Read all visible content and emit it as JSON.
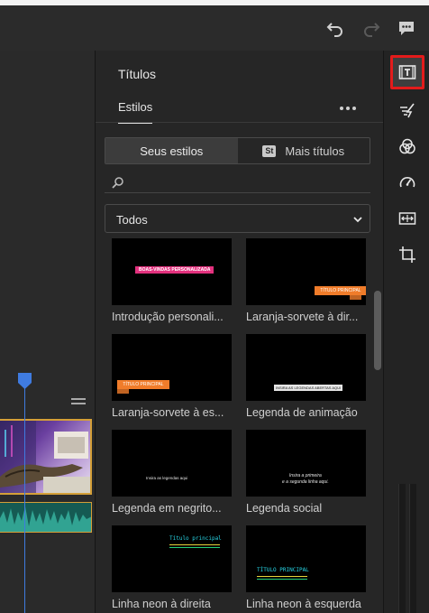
{
  "toolbar": {
    "undo_icon": "undo-icon",
    "redo_icon": "redo-icon",
    "comment_icon": "comment-icon"
  },
  "panel": {
    "title": "Títulos",
    "tab_label": "Estilos",
    "more_icon": "more-icon",
    "segment": {
      "yours": "Seus estilos",
      "more_badge": "St",
      "more": "Mais títulos",
      "active": "yours"
    },
    "search": {
      "icon": "search-icon",
      "placeholder": ""
    },
    "filter": {
      "selected": "Todos",
      "chevron": "chevron-down-icon"
    },
    "cards": [
      {
        "label": "Introdução personali...",
        "overlay": "BOAS-VINDAS PERSONALIZADA"
      },
      {
        "label": "Laranja-sorvete à dir...",
        "overlay": "TÍTULO PRINCIPAL"
      },
      {
        "label": "Laranja-sorvete à es...",
        "overlay": "TÍTULO PRINCIPAL"
      },
      {
        "label": "Legenda de animação",
        "overlay": "INSIRA AS LEGENDAS ABERTAS AQUI"
      },
      {
        "label": "Legenda em negrito...",
        "overlay": "Insira as legendas aqui"
      },
      {
        "label": "Legenda social",
        "overlay_line1": "Insira a primeira",
        "overlay_line2": "e a segunda linha aqui."
      },
      {
        "label": "Linha neon à direita",
        "overlay": "Título principal"
      },
      {
        "label": "Linha neon à esquerda",
        "overlay": "TÍTULO PRINCIPAL"
      }
    ]
  },
  "rail": {
    "items": [
      {
        "icon": "titles-icon",
        "active": true
      },
      {
        "icon": "transitions-icon",
        "active": false
      },
      {
        "icon": "color-icon",
        "active": false
      },
      {
        "icon": "speed-icon",
        "active": false
      },
      {
        "icon": "fit-icon",
        "active": false
      },
      {
        "icon": "crop-icon",
        "active": false
      }
    ]
  },
  "colors": {
    "accent_red": "#e31b1b",
    "playhead_blue": "#3f7be0",
    "clip_border": "#d49f38",
    "pink": "#e3317e",
    "orange": "#f07c2a",
    "neon_cyan": "#28d7e8",
    "neon_yellow": "#e8d23a",
    "neon_green": "#23d07a"
  }
}
